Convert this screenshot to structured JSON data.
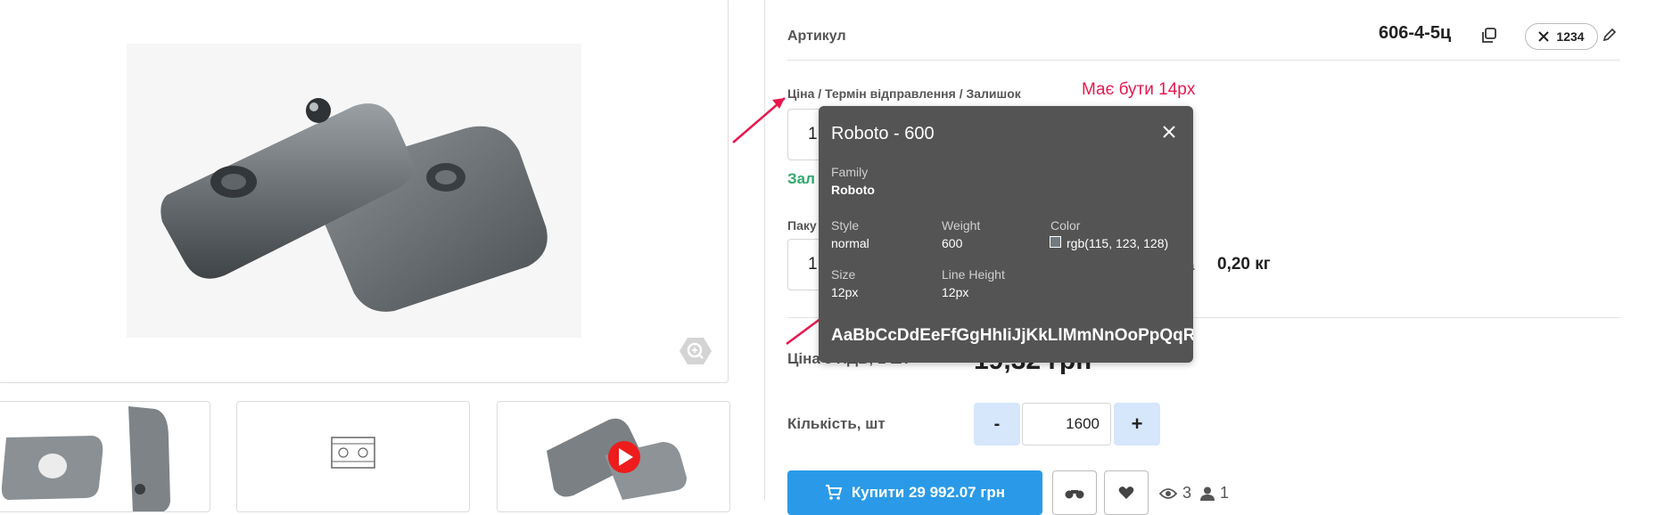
{
  "product": {
    "sku_label": "Артикул",
    "sku_value": "606-4-5ц",
    "qty_chip": "1234",
    "price_header": "Ціна / Термін відправлення / Залишок",
    "price_field_partial": "1",
    "stock_partial": "Зал",
    "package_label_partial": "Паку",
    "package_field_partial": "1",
    "weight_label_partial": "а",
    "weight_value": "0,20 кг",
    "vat_label": "Ціна з ПДВ, 1 шт",
    "price_value": "19,32 грн",
    "qty_label": "Кількість, шт",
    "qty_minus": "-",
    "qty_value": "1600",
    "qty_plus": "+",
    "buy_label": "Купити 29 992.07 грн",
    "views_count": "3",
    "buyers_count": "1"
  },
  "annotation": {
    "text": "Має бути 14px",
    "color": "#e8174d"
  },
  "tooltip": {
    "title": "Roboto - 600",
    "family_key": "Family",
    "family_val": "Roboto",
    "style_key": "Style",
    "style_val": "normal",
    "weight_key": "Weight",
    "weight_val": "600",
    "color_key": "Color",
    "color_val": "rgb(115, 123, 128)",
    "size_key": "Size",
    "size_val": "12px",
    "line_height_key": "Line Height",
    "line_height_val": "12px",
    "sample": "AaBbCcDdEeFfGgHhIiJjKkLlMmNnOoPpQqRr"
  },
  "icons": {
    "zoom": "zoom-icon",
    "copy": "copy-icon",
    "close_chip": "close-icon",
    "edit": "pencil-icon",
    "tooltip_close": "close-icon",
    "play": "play-icon",
    "cart": "cart-icon",
    "compare": "binoculars-icon",
    "wishlist": "heart-icon",
    "views": "eye-icon",
    "buyers": "user-icon"
  },
  "colors": {
    "accent": "#2a9ae8",
    "stock": "#2daa6b",
    "qty_button": "#d6e6fb"
  }
}
